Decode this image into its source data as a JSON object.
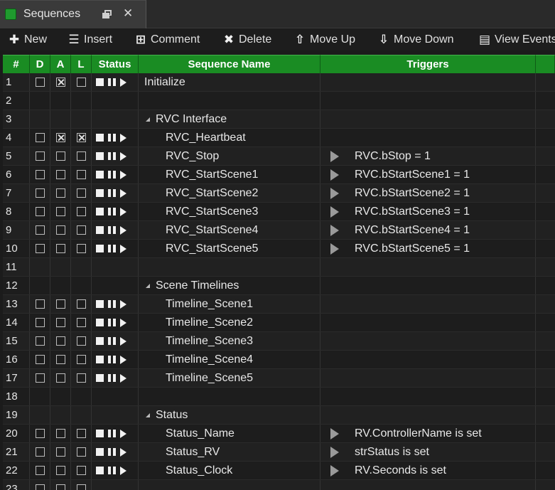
{
  "tab": {
    "title": "Sequences",
    "accent": "#1f9a2e"
  },
  "toolbar": [
    {
      "icon": "plus-icon",
      "label": "New"
    },
    {
      "icon": "insert-icon",
      "label": "Insert"
    },
    {
      "icon": "comment-icon",
      "label": "Comment"
    },
    {
      "icon": "delete-icon",
      "label": "Delete"
    },
    {
      "icon": "move-up-icon",
      "label": "Move Up"
    },
    {
      "icon": "move-down-icon",
      "label": "Move Down"
    },
    {
      "icon": "view-events-icon",
      "label": "View Events"
    }
  ],
  "columns": {
    "num": "#",
    "d": "D",
    "a": "A",
    "l": "L",
    "status": "Status",
    "name": "Sequence Name",
    "triggers": "Triggers"
  },
  "rows": [
    {
      "num": "1",
      "type": "seq",
      "d": false,
      "a": true,
      "l": false,
      "name": "Initialize",
      "indent": false,
      "trigger": ""
    },
    {
      "num": "2",
      "type": "blank"
    },
    {
      "num": "3",
      "type": "group",
      "name": "RVC Interface"
    },
    {
      "num": "4",
      "type": "seq",
      "d": false,
      "a": true,
      "l": true,
      "name": "RVC_Heartbeat",
      "indent": true,
      "trigger": ""
    },
    {
      "num": "5",
      "type": "seq",
      "d": false,
      "a": false,
      "l": false,
      "name": "RVC_Stop",
      "indent": true,
      "trigger": "RVC.bStop = 1"
    },
    {
      "num": "6",
      "type": "seq",
      "d": false,
      "a": false,
      "l": false,
      "name": "RVC_StartScene1",
      "indent": true,
      "trigger": "RVC.bStartScene1 = 1"
    },
    {
      "num": "7",
      "type": "seq",
      "d": false,
      "a": false,
      "l": false,
      "name": "RVC_StartScene2",
      "indent": true,
      "trigger": "RVC.bStartScene2 = 1"
    },
    {
      "num": "8",
      "type": "seq",
      "d": false,
      "a": false,
      "l": false,
      "name": "RVC_StartScene3",
      "indent": true,
      "trigger": "RVC.bStartScene3 = 1"
    },
    {
      "num": "9",
      "type": "seq",
      "d": false,
      "a": false,
      "l": false,
      "name": "RVC_StartScene4",
      "indent": true,
      "trigger": "RVC.bStartScene4 = 1"
    },
    {
      "num": "10",
      "type": "seq",
      "d": false,
      "a": false,
      "l": false,
      "name": "RVC_StartScene5",
      "indent": true,
      "trigger": "RVC.bStartScene5 = 1"
    },
    {
      "num": "11",
      "type": "blank"
    },
    {
      "num": "12",
      "type": "group",
      "name": "Scene Timelines"
    },
    {
      "num": "13",
      "type": "seq",
      "d": false,
      "a": false,
      "l": false,
      "name": "Timeline_Scene1",
      "indent": true,
      "trigger": ""
    },
    {
      "num": "14",
      "type": "seq",
      "d": false,
      "a": false,
      "l": false,
      "name": "Timeline_Scene2",
      "indent": true,
      "trigger": ""
    },
    {
      "num": "15",
      "type": "seq",
      "d": false,
      "a": false,
      "l": false,
      "name": "Timeline_Scene3",
      "indent": true,
      "trigger": ""
    },
    {
      "num": "16",
      "type": "seq",
      "d": false,
      "a": false,
      "l": false,
      "name": "Timeline_Scene4",
      "indent": true,
      "trigger": ""
    },
    {
      "num": "17",
      "type": "seq",
      "d": false,
      "a": false,
      "l": false,
      "name": "Timeline_Scene5",
      "indent": true,
      "trigger": ""
    },
    {
      "num": "18",
      "type": "blank"
    },
    {
      "num": "19",
      "type": "group",
      "name": "Status"
    },
    {
      "num": "20",
      "type": "seq",
      "d": false,
      "a": false,
      "l": false,
      "name": "Status_Name",
      "indent": true,
      "trigger": "RV.ControllerName is set"
    },
    {
      "num": "21",
      "type": "seq",
      "d": false,
      "a": false,
      "l": false,
      "name": "Status_RV",
      "indent": true,
      "trigger": "strStatus is set"
    },
    {
      "num": "22",
      "type": "seq",
      "d": false,
      "a": false,
      "l": false,
      "name": "Status_Clock",
      "indent": true,
      "trigger": "RV.Seconds is set"
    },
    {
      "num": "23",
      "type": "partial",
      "d": false,
      "a": false,
      "l": false
    }
  ]
}
